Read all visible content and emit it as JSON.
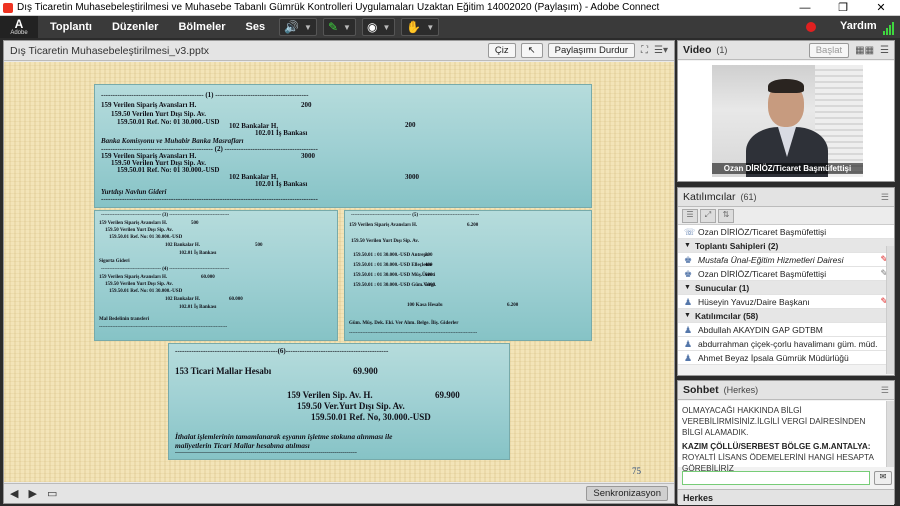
{
  "window": {
    "title": "Dış Ticaretin Muhasebeleştirilmesi ve Muhasebe Tabanlı Gümrük Kontrolleri Uygulamaları Uzaktan Eğitim 14002020 (Paylaşım) - Adobe Connect",
    "minimize": "—",
    "maximize": "❐",
    "close": "✕"
  },
  "menubar": {
    "logo_mark": "A",
    "logo_text": "Adobe",
    "items": [
      "Toplantı",
      "Düzenler",
      "Bölmeler",
      "Ses"
    ],
    "help": "Yardım",
    "accent_green": "#3fd63f",
    "record_color": "#e02020"
  },
  "share": {
    "file_name": "Dış Ticaretin Muhasebeleştirilmesi_v3.pptx",
    "draw_button": "Çiz",
    "stop_share_button": "Paylaşımı Durdur",
    "sync_button": "Senkronizasyon",
    "page_number": "75"
  },
  "slide": {
    "top": {
      "l1": "-------------------------------------------- (1) ----------------------------------------",
      "l2": "159 Verilen Sipariş Avansları H.",
      "l2v": "200",
      "l3": "159.50 Verilen Yurt Dışı Sip. Av.",
      "l4": "159.50.01 Ref. No: 01 30.000.-USD",
      "l4v": "200",
      "l5": "102 Bankalar H.",
      "l6": "102.01 İş Bankası",
      "l7": "Banka Komisyonu ve Muhabir Banka Masrafları",
      "l8": "------------------------------------------------ (2) ----------------------------------------",
      "l9": "159 Verilen Sipariş Avansları H.",
      "l9v": "3000",
      "l10": "159.50 Verilen Yurt Dışı Sip. Av.",
      "l11": "159.50.01 Ref. No: 01 30.000.-USD",
      "l12": "102 Bankalar H.",
      "l12v": "3000",
      "l13": "102.01 İş Bankası",
      "l14": "Yurtdışı Navlun Gideri",
      "l15": "---------------------------------------------------------------------------------------------"
    },
    "left": {
      "l1": "------------------------------------ (3) ------------------------------------",
      "l2": "159 Verilen Sipariş Avansları H.",
      "l2v": "500",
      "l3": "159.50 Verilen Yurt Dışı Sip. Av.",
      "l4": "159.50.01 Ref. No: 01 30.000.-USD",
      "l5": "102 Bankalar H.",
      "l5v": "500",
      "l6": "102.01 İş Bankası",
      "l7": "Sigorta Gideri",
      "l8": "------------------------------------ (4) ------------------------------------",
      "l9": "159 Verilen Sipariş Avansları H.",
      "l9v": "60.000",
      "l10": "159.50 Verilen Yurt Dışı Sip. Av.",
      "l11": "159.50.01 Ref. No: 01 30.000.-USD",
      "l12": "102 Bankalar H.",
      "l12v": "60.000",
      "l13": "102.01 İş Bankası",
      "l14": "Mal Bedelinin transferi",
      "l15": "-----------------------------------------------------------------------------"
    },
    "right": {
      "l1": "------------------------------------ (5) ------------------------------------",
      "l2": "159 Verilen Sipariş Avansları H.",
      "l2v": "6.200",
      "l3": "159.50 Verilen Yurt Dışı Sip. Av.",
      "l4": "159.50.01 : 01 30.000.-USD Antrepo",
      "l4v": "300",
      "l5": "159.50.01 : 01 30.000.-USD Elleçleme",
      "l5v": "400",
      "l6": "159.50.01 : 01 30.000.-USD Müş.Ücreti",
      "l6v": "600",
      "l7": "159.50.01 : 01 30.000.-USD Güm.Vergi.",
      "l7v": "5000",
      "l8": "100 Kasa Hesabı",
      "l8v": "6.200",
      "l9": "Güm. Müş. Dek. Eki. Ver Alım. Belge. İliş. Giderler",
      "l10": "-----------------------------------------------------------------------------"
    },
    "bottom": {
      "l1": "--------------------------------------------(6)--------------------------------------------",
      "l2": "153 Ticari Mallar Hesabı",
      "l2v": "69.900",
      "l3": "159 Verilen Sip. Av. H.",
      "l3v": "69.900",
      "l4": "159.50 Ver.Yurt Dışı Sip. Av.",
      "l5": "159.50.01  Ref. No, 30.000.-USD",
      "l6": "İthalat işlemlerinin tamamlanarak eşyanın işletme stokuna alınması ile",
      "l7": "maliyetlerin Ticari Mallar hesabına atılması",
      "l8": "-------------------------------------------------------------------------------------------"
    }
  },
  "video": {
    "title": "Video",
    "count": "(1)",
    "start_button": "Başlat",
    "label": "Ozan DİRİÖZ/Ticaret Başmüfettişi"
  },
  "attendees": {
    "title": "Katılımcılar",
    "count": "(61)",
    "me": "Ozan DİRİÖZ/Ticaret Başmüfettişi",
    "hosts_section": "Toplantı Sahipleri (2)",
    "hosts": [
      "Mustafa Ünal-Eğitim Hizmetleri Dairesi",
      "Ozan DİRİÖZ/Ticaret Başmüfettişi"
    ],
    "presenters_section": "Sunucular (1)",
    "presenters": [
      "Hüseyin Yavuz/Daire Başkanı"
    ],
    "participants_section": "Katılımcılar (58)",
    "participants": [
      "Abdullah AKAYDIN GAP GDTBM",
      "abdurrahman çiçek-çorlu havalimanı güm. müd.",
      "Ahmet Beyaz İpsala Gümrük Müdürlüğü"
    ]
  },
  "chat": {
    "title": "Sohbet",
    "scope": "(Herkes)",
    "msg1": "OLMAYACAĞI HAKKINDA BİLGİ VEREBİLİRMİSİNİZ.İLGİLİ VERGİ DAİRESİNDEN BİLGİ ALAMADIK.",
    "msg2_author": "KAZIM ÇÖLLÜ/SERBEST BÖLGE G.M.ANTALYA:",
    "msg2": "ROYALTİ LİSANS ÖDEMELERİNİ HANGİ HESAPTA GÖREBİLİRİZ",
    "footer": "Herkes"
  }
}
